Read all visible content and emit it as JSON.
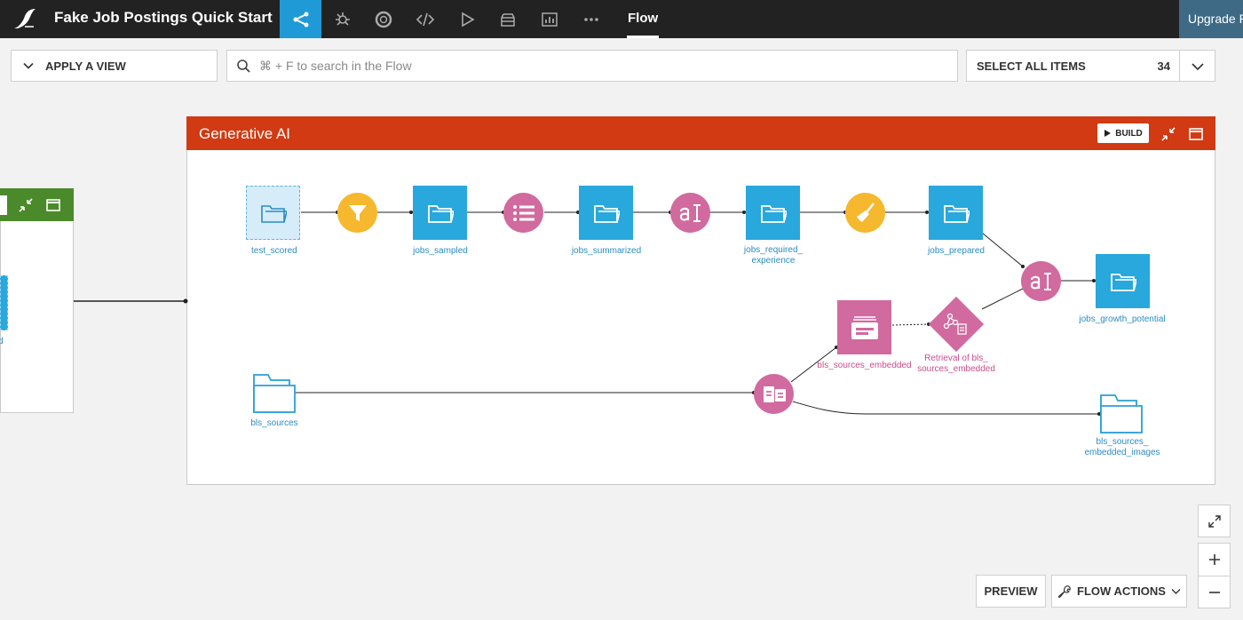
{
  "app": {
    "project_title": "Fake Job Postings Quick Start",
    "active_tab": "Flow",
    "upgrade_label": "Upgrade P",
    "nav_icons": [
      "flow-icon",
      "lab-icon",
      "lifebuoy-icon",
      "code-icon",
      "play-icon",
      "database-icon",
      "dashboard-icon",
      "more-icon"
    ]
  },
  "toolbar": {
    "apply_view_label": "APPLY A VIEW",
    "search_placeholder": "⌘ + F to search in the Flow",
    "select_all_label": "SELECT ALL ITEMS",
    "select_count": "34"
  },
  "left_zone": {
    "partial_label": "d"
  },
  "zone": {
    "title": "Generative AI",
    "build_label": "BUILD",
    "header_color": "#d13a12"
  },
  "nodes": {
    "test_scored": "test_scored",
    "jobs_sampled": "jobs_sampled",
    "jobs_summarized": "jobs_summarized",
    "jobs_required_1": "jobs_required_",
    "jobs_required_2": "experience",
    "jobs_prepared": "jobs_prepared",
    "jobs_growth_potential": "jobs_growth_potential",
    "bls_sources_embedded": "bls_sources_embedded",
    "retrieval_1": "Retrieval of bls_",
    "retrieval_2": "sources_embedded",
    "bls_sources": "bls_sources",
    "bls_images_1": "bls_sources_",
    "bls_images_2": "embedded_images"
  },
  "controls": {
    "preview_label": "PREVIEW",
    "flow_actions_label": "FLOW ACTIONS"
  },
  "colors": {
    "dataset": "#28a8dc",
    "recipe_yellow": "#f5b82e",
    "recipe_pink": "#d16a9f",
    "topbar": "#222222",
    "active_nav": "#1f9ad6"
  }
}
